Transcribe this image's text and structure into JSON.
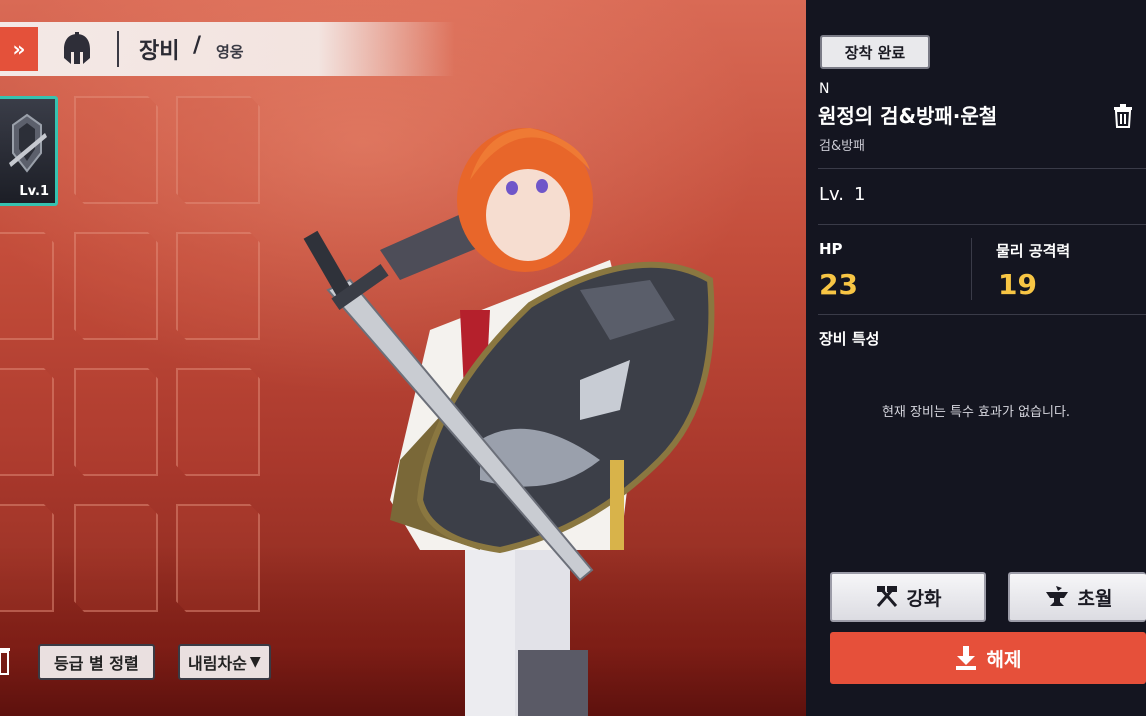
{
  "header": {
    "back_icon": "double-chevron-right-icon",
    "helmet_icon": "spartan-helmet-icon",
    "title": "장비",
    "separator": "/",
    "subtitle": "영웅"
  },
  "inventory": {
    "equipped_slot": {
      "level_label": "Lv.1",
      "icon": "armor-icon",
      "border_color": "#36c2b0"
    },
    "empty_slot_count": 11
  },
  "sort": {
    "grade_sort_label": "등급 별 정렬",
    "order_label": "내림차순",
    "order_icon": "triangle-down-icon"
  },
  "panel": {
    "status_badge": "장착 완료",
    "grade": "N",
    "item_name": "원정의 검&방패·운철",
    "item_type": "검&방패",
    "delete_icon": "trash-icon",
    "level_label": "Lv.",
    "level_value": "1",
    "stats": [
      {
        "label": "HP",
        "value": "23"
      },
      {
        "label": "물리 공격력",
        "value": "19"
      }
    ],
    "feature_title": "장비 특성",
    "feature_text": "현재 장비는 특수 효과가 없습니다.",
    "enhance_label": "강화",
    "enhance_icon": "hammer-pick-icon",
    "transcend_label": "초월",
    "transcend_icon": "anvil-icon",
    "unequip_label": "해제",
    "unequip_icon": "download-arrow-icon",
    "accent_color": "#e6503a",
    "stat_color": "#f7c544"
  }
}
